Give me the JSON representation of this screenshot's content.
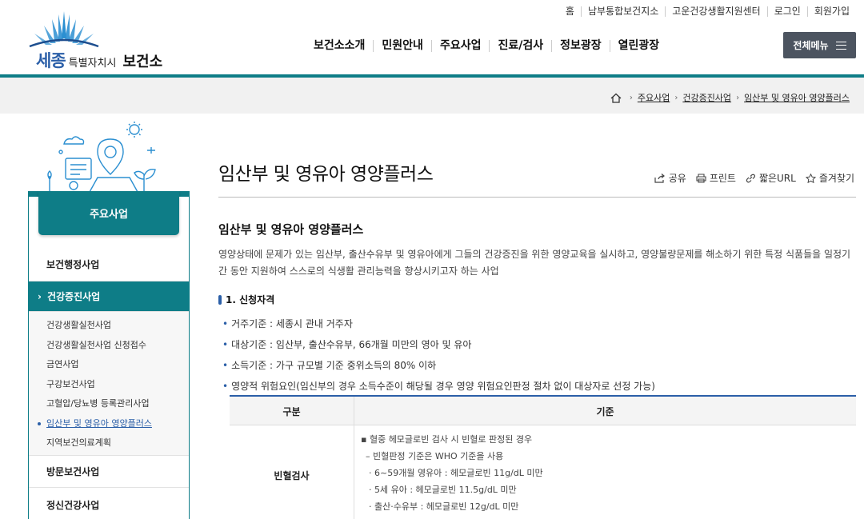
{
  "util_links": [
    "홈",
    "남부통합보건지소",
    "고운건강생활지원센터",
    "로그인",
    "회원가입"
  ],
  "logo": {
    "sejong": "세종",
    "special": "특별자치시",
    "bogeon": "보건소"
  },
  "gnb": [
    "보건소소개",
    "민원안내",
    "주요사업",
    "진료/검사",
    "정보광장",
    "열린광장"
  ],
  "all_menu_label": "전체메뉴",
  "breadcrumb": [
    "주요사업",
    "건강증진사업",
    "임산부 및 영유아 영양플러스"
  ],
  "sidebar": {
    "heading": "주요사업",
    "item_0": "보건행정사업",
    "item_1": "건강증진사업",
    "subs": [
      "건강생활실천사업",
      "건강생활실천사업 신청접수",
      "금연사업",
      "구강보건사업",
      "고혈압/당뇨병 등록관리사업",
      "임산부 및 영유아 영양플러스",
      "지역보건의료계획"
    ],
    "item_2": "방문보건사업",
    "item_3": "정신건강사업"
  },
  "page_title": "임산부 및 영유아 영양플러스",
  "actions": [
    "공유",
    "프린트",
    "짧은URL",
    "즐겨찾기"
  ],
  "section_title": "임산부 및 영유아 영양플러스",
  "description": "영양상태에 문제가 있는 임산부, 출산수유부 및 영유아에게 그들의 건강증진을 위한 영양교육을 실시하고, 영양불량문제를 해소하기 위한 특정 식품들을 일정기간 동안 지원하여 스스로의 식생활 관리능력을 향상시키고자 하는 사업",
  "heading_1": "1. 신청자격",
  "bullets": [
    "거주기준 : 세종시 관내 거주자",
    "대상기준 : 임산부, 출산수유부, 66개월 미만의 영아 및 유아",
    "소득기준 : 가구 규모별 기준 중위소득의 80% 이하",
    "영양적 위험요인(임신부의 경우 소득수준이 해당될 경우 영양 위험요인판정 절차 없이 대상자로 선정 가능)"
  ],
  "table": {
    "headers": [
      "구분",
      "기준"
    ],
    "row_label": "빈혈검사",
    "lines": [
      "▪ 혈중 헤모글로빈 검사 시 빈혈로 판정된 경우",
      "– 빈혈판정 기준은 WHO 기준을 사용",
      "· 6~59개월 영유아 : 헤모글로빈 11g/dL 미만",
      "· 5세 유아 : 헤모글로빈 11.5g/dL 미만",
      "· 출산·수유부 : 헤모글로빈 12g/dL 미만"
    ]
  },
  "colors": {
    "teal": "#0e7d87",
    "blue": "#2b5fa8",
    "dark_button": "#4c5460"
  }
}
